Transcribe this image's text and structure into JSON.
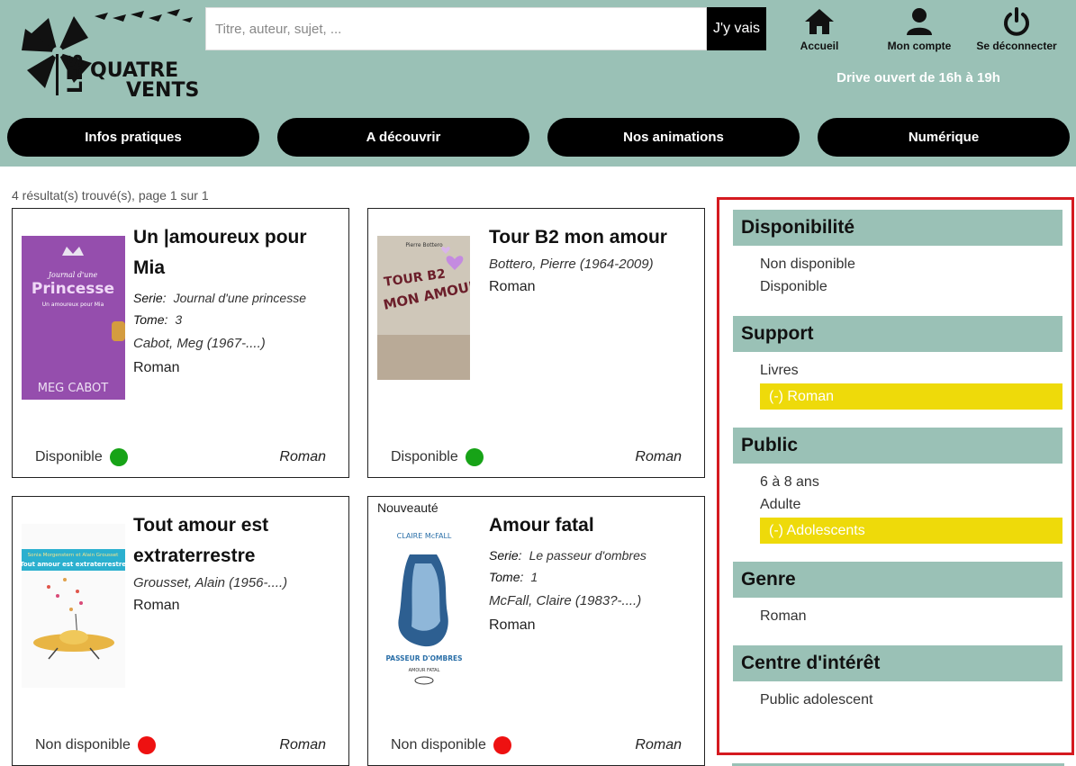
{
  "header": {
    "logo_text_les": "LES",
    "logo_text_quatre": "QUATRE",
    "logo_text_vents": "VENTS",
    "search_placeholder": "Titre, auteur, sujet, ...",
    "search_button": "J'y vais",
    "nav": [
      {
        "label": "Accueil",
        "icon": "home-icon"
      },
      {
        "label": "Mon compte",
        "icon": "user-icon"
      },
      {
        "label": "Se déconnecter",
        "icon": "power-icon"
      }
    ],
    "drive_text": "Drive ouvert de 16h à 19h",
    "menu": [
      "Infos pratiques",
      "A découvrir",
      "Nos animations",
      "Numérique"
    ]
  },
  "results": {
    "count_text": "4 résultat(s) trouvé(s), page 1 sur 1",
    "serie_label": "Serie:",
    "tome_label": "Tome:",
    "items": [
      {
        "title": "Un |amoureux pour Mia",
        "serie": "Journal d'une princesse",
        "tome": "3",
        "author": "Cabot, Meg (1967-....)",
        "genre": "Roman",
        "status": "Disponible",
        "status_color": "#17a317",
        "genre_tag": "Roman",
        "cover_top": "Journal d'une",
        "cover_title": "Princesse",
        "cover_sub": "Un amoureux pour Mia",
        "cover_author": "MEG CABOT"
      },
      {
        "title": "Tour B2 mon amour",
        "author": "Bottero, Pierre (1964-2009)",
        "genre": "Roman",
        "status": "Disponible",
        "status_color": "#17a317",
        "genre_tag": "Roman",
        "cover_author": "Pierre Bottero",
        "cover_title1": "TOUR B2",
        "cover_title2": "MON AMOUR"
      },
      {
        "title": "Tout amour est extraterrestre",
        "author": "Grousset, Alain (1956-....)",
        "genre": "Roman",
        "status": "Non disponible",
        "status_color": "#ee1111",
        "genre_tag": "Roman",
        "cover_authors": "Sonia Morgenstern et Alain Grousset",
        "cover_title": "Tout amour est extraterrestre"
      },
      {
        "badge": "Nouveauté",
        "title": "Amour fatal",
        "serie": "Le passeur d'ombres",
        "tome": "1",
        "author": "McFall, Claire (1983?-....)",
        "genre": "Roman",
        "status": "Non disponible",
        "status_color": "#ee1111",
        "genre_tag": "Roman",
        "cover_author": "CLAIRE McFALL",
        "cover_title": "PASSEUR D'OMBRES",
        "cover_sub": "AMOUR FATAL"
      }
    ]
  },
  "facets": [
    {
      "title": "Disponibilité",
      "items": [
        {
          "label": "Non disponible"
        },
        {
          "label": "Disponible"
        }
      ]
    },
    {
      "title": "Support",
      "items": [
        {
          "label": "Livres"
        },
        {
          "label": "(-) Roman",
          "active": true
        }
      ]
    },
    {
      "title": "Public",
      "items": [
        {
          "label": "6 à 8 ans"
        },
        {
          "label": "Adulte"
        },
        {
          "label": "(-) Adolescents",
          "active": true
        }
      ]
    },
    {
      "title": "Genre",
      "items": [
        {
          "label": "Roman"
        }
      ]
    },
    {
      "title": "Centre d'intérêt",
      "items": [
        {
          "label": "Public adolescent"
        }
      ]
    }
  ],
  "colors": {
    "header_bg": "#9ac1b6",
    "facet_active": "#eeda0a",
    "facet_border": "#d51a20"
  }
}
